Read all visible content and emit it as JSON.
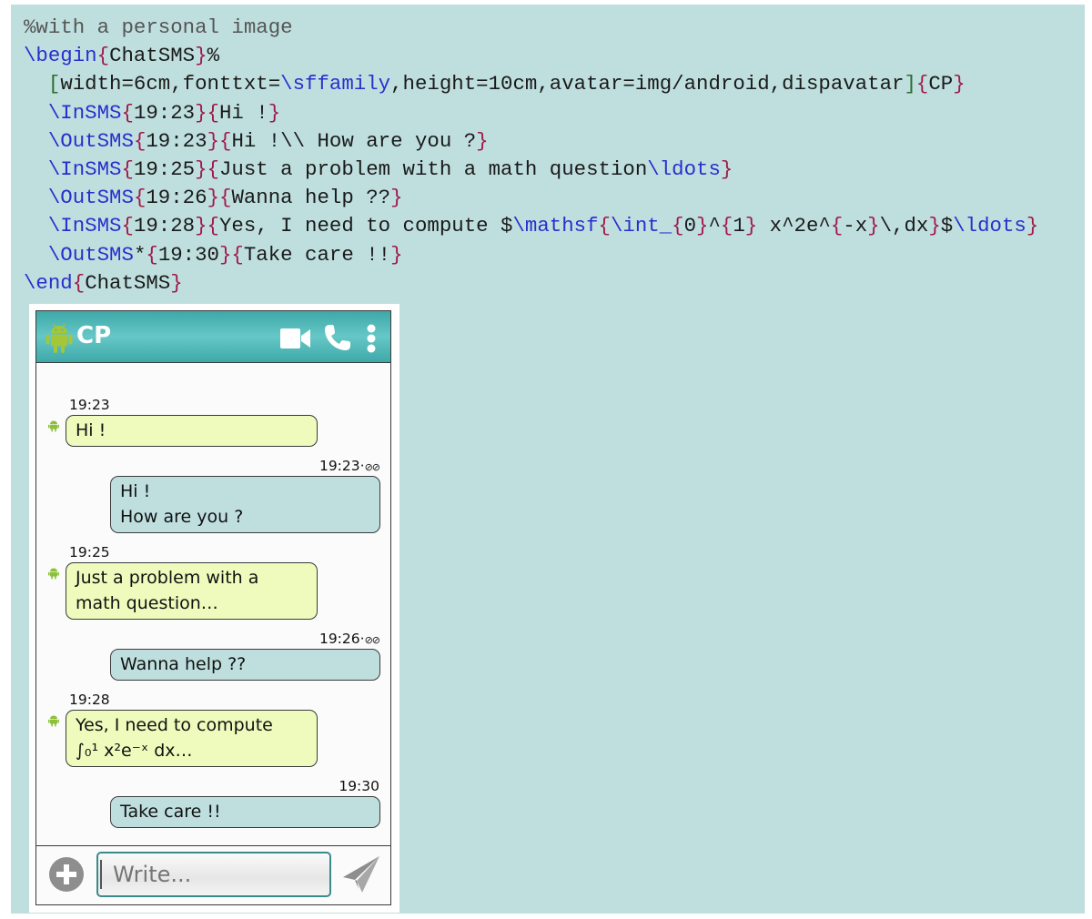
{
  "code": {
    "lines": [
      [
        {
          "t": "comment",
          "v": "%with a personal image"
        }
      ],
      [
        {
          "t": "cmd",
          "v": "\\begin"
        },
        {
          "t": "brace",
          "v": "{"
        },
        {
          "t": "text",
          "v": "ChatSMS"
        },
        {
          "t": "brace",
          "v": "}"
        },
        {
          "t": "text",
          "v": "%"
        }
      ],
      [
        {
          "t": "text",
          "v": "  "
        },
        {
          "t": "bracket",
          "v": "["
        },
        {
          "t": "text",
          "v": "width=6cm,fonttxt="
        },
        {
          "t": "cmd",
          "v": "\\sffamily"
        },
        {
          "t": "text",
          "v": ",height=10cm,avatar=img/android,dispavatar"
        },
        {
          "t": "bracket",
          "v": "]"
        },
        {
          "t": "brace",
          "v": "{"
        },
        {
          "t": "text",
          "v": "CP"
        },
        {
          "t": "brace",
          "v": "}"
        }
      ],
      [
        {
          "t": "text",
          "v": "  "
        },
        {
          "t": "cmd",
          "v": "\\InSMS"
        },
        {
          "t": "brace",
          "v": "{"
        },
        {
          "t": "text",
          "v": "19:23"
        },
        {
          "t": "brace",
          "v": "}{"
        },
        {
          "t": "text",
          "v": "Hi !"
        },
        {
          "t": "brace",
          "v": "}"
        }
      ],
      [
        {
          "t": "text",
          "v": "  "
        },
        {
          "t": "cmd",
          "v": "\\OutSMS"
        },
        {
          "t": "brace",
          "v": "{"
        },
        {
          "t": "text",
          "v": "19:23"
        },
        {
          "t": "brace",
          "v": "}{"
        },
        {
          "t": "text",
          "v": "Hi !\\\\ How are you ?"
        },
        {
          "t": "brace",
          "v": "}"
        }
      ],
      [
        {
          "t": "text",
          "v": "  "
        },
        {
          "t": "cmd",
          "v": "\\InSMS"
        },
        {
          "t": "brace",
          "v": "{"
        },
        {
          "t": "text",
          "v": "19:25"
        },
        {
          "t": "brace",
          "v": "}{"
        },
        {
          "t": "text",
          "v": "Just a problem with a math question"
        },
        {
          "t": "cmd",
          "v": "\\ldots"
        },
        {
          "t": "brace",
          "v": "}"
        }
      ],
      [
        {
          "t": "text",
          "v": "  "
        },
        {
          "t": "cmd",
          "v": "\\OutSMS"
        },
        {
          "t": "brace",
          "v": "{"
        },
        {
          "t": "text",
          "v": "19:26"
        },
        {
          "t": "brace",
          "v": "}{"
        },
        {
          "t": "text",
          "v": "Wanna help ??"
        },
        {
          "t": "brace",
          "v": "}"
        }
      ],
      [
        {
          "t": "text",
          "v": "  "
        },
        {
          "t": "cmd",
          "v": "\\InSMS"
        },
        {
          "t": "brace",
          "v": "{"
        },
        {
          "t": "text",
          "v": "19:28"
        },
        {
          "t": "brace",
          "v": "}{"
        },
        {
          "t": "text",
          "v": "Yes, I need to compute $"
        },
        {
          "t": "cmd",
          "v": "\\mathsf"
        },
        {
          "t": "brace",
          "v": "{"
        },
        {
          "t": "cmd",
          "v": "\\int_"
        },
        {
          "t": "brace",
          "v": "{"
        },
        {
          "t": "text",
          "v": "0"
        },
        {
          "t": "brace",
          "v": "}"
        },
        {
          "t": "text",
          "v": "^"
        },
        {
          "t": "brace",
          "v": "{"
        },
        {
          "t": "text",
          "v": "1"
        },
        {
          "t": "brace",
          "v": "}"
        },
        {
          "t": "text",
          "v": " x^2e^"
        },
        {
          "t": "brace",
          "v": "{"
        },
        {
          "t": "text",
          "v": "-x"
        },
        {
          "t": "brace",
          "v": "}"
        },
        {
          "t": "text",
          "v": "\\,dx"
        },
        {
          "t": "brace",
          "v": "}"
        },
        {
          "t": "text",
          "v": "$"
        },
        {
          "t": "cmd",
          "v": "\\ldots"
        },
        {
          "t": "brace",
          "v": "}"
        }
      ],
      [
        {
          "t": "text",
          "v": "  "
        },
        {
          "t": "cmd",
          "v": "\\OutSMS"
        },
        {
          "t": "text",
          "v": "*"
        },
        {
          "t": "brace",
          "v": "{"
        },
        {
          "t": "text",
          "v": "19:30"
        },
        {
          "t": "brace",
          "v": "}{"
        },
        {
          "t": "text",
          "v": "Take care !!"
        },
        {
          "t": "brace",
          "v": "}"
        }
      ],
      [
        {
          "t": "cmd",
          "v": "\\end"
        },
        {
          "t": "brace",
          "v": "{"
        },
        {
          "t": "text",
          "v": "ChatSMS"
        },
        {
          "t": "brace",
          "v": "}"
        }
      ]
    ]
  },
  "phone": {
    "header": {
      "avatar_icon": "android-icon",
      "contact_name": "CP",
      "icons": [
        "video-camera-icon",
        "phone-icon",
        "more-vertical-icon"
      ],
      "header_color": "#3ea8a8"
    },
    "messages": [
      {
        "direction": "in",
        "time": "19:23",
        "lines": [
          "Hi !"
        ],
        "read_receipt": false
      },
      {
        "direction": "out",
        "time": "19:23",
        "lines": [
          "Hi !",
          "How are you ?"
        ],
        "read_receipt": true
      },
      {
        "direction": "in",
        "time": "19:25",
        "lines": [
          "Just a problem with a",
          "math question…"
        ],
        "read_receipt": false
      },
      {
        "direction": "out",
        "time": "19:26",
        "lines": [
          "Wanna help ??"
        ],
        "read_receipt": true
      },
      {
        "direction": "in",
        "time": "19:28",
        "lines": [
          "Yes, I need to compute",
          "∫₀¹ x²e⁻ˣ dx…"
        ],
        "read_receipt": false
      },
      {
        "direction": "out",
        "time": "19:30",
        "lines": [
          "Take care !!"
        ],
        "read_receipt": false
      }
    ],
    "receipt_separator": "·",
    "receipt_glyph": "⊘⊘",
    "incoming_color": "#effbbc",
    "outgoing_color": "#bfdfdf",
    "compose": {
      "placeholder": "Write...",
      "add_icon": "plus-circle-icon",
      "send_icon": "send-paper-plane-icon"
    }
  }
}
